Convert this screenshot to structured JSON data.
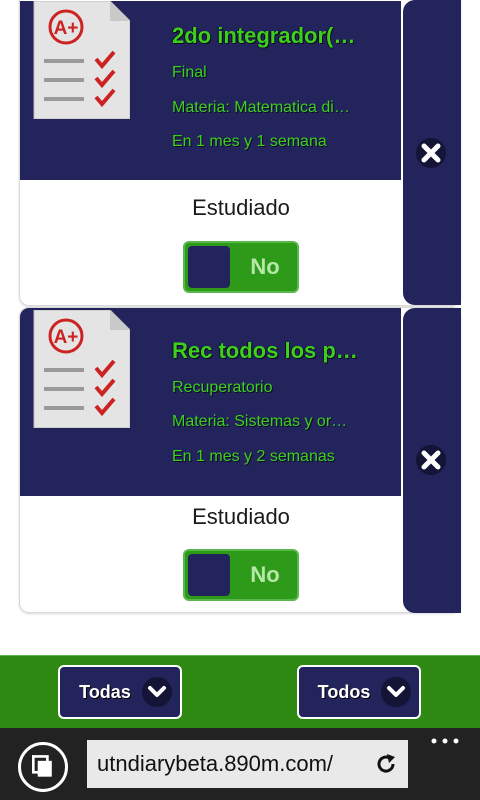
{
  "cards": [
    {
      "title": "2do integrador(…",
      "type": "Final",
      "subject": "Materia: Matematica di…",
      "due": "En 1 mes y 1 semana",
      "studied_label": "Estudiado",
      "toggle": "No"
    },
    {
      "title": "Rec todos los p…",
      "type": "Recuperatorio",
      "subject": "Materia: Sistemas y or…",
      "due": "En 1 mes y 2 semanas",
      "studied_label": "Estudiado",
      "toggle": "No"
    }
  ],
  "filters": {
    "left_label": "Todas",
    "right_label": "Todos"
  },
  "browser": {
    "url": "utndiarybeta.890m.com/"
  },
  "colors": {
    "card_bg": "#23245c",
    "accent_green": "#3cd01c",
    "bar_green": "#2f8a13"
  },
  "icons": [
    "grade-sheet-icon",
    "close-icon",
    "chevron-down-icon",
    "tabs-icon",
    "refresh-icon",
    "more-icon"
  ]
}
